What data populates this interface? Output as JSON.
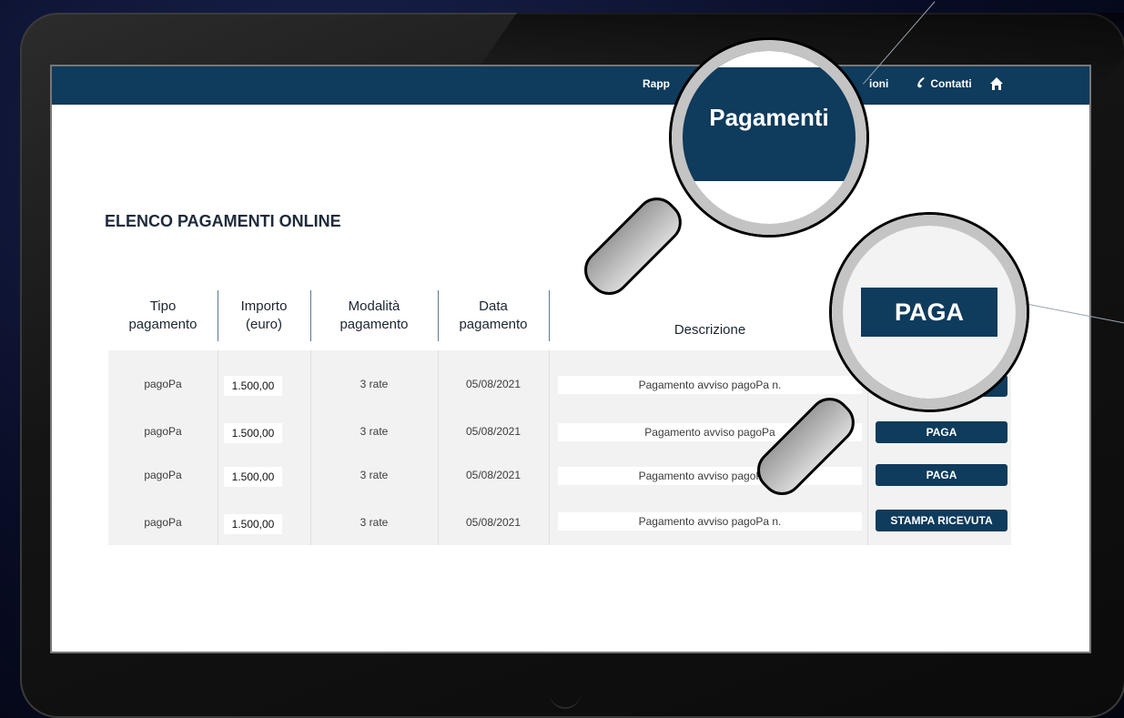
{
  "header": {
    "nav_partial_left": "Rapp",
    "nav_partial_right": "ioni",
    "contacts": "Contatti"
  },
  "page": {
    "title": "ELENCO PAGAMENTI ONLINE"
  },
  "table": {
    "headers": [
      {
        "line1": "Tipo",
        "line2": "pagamento"
      },
      {
        "line1": "Importo",
        "line2": "(euro)"
      },
      {
        "line1": "Modalità",
        "line2": "pagamento"
      },
      {
        "line1": "Data",
        "line2": "pagamento"
      },
      {
        "line1": "Descrizione",
        "line2": ""
      }
    ],
    "rows": [
      {
        "tipo": "pagoPa",
        "importo": "1.500,00",
        "modalita": "3 rate",
        "data": "05/08/2021",
        "descrizione": "Pagamento avviso pagoPa n.",
        "action": ""
      },
      {
        "tipo": "pagoPa",
        "importo": "1.500,00",
        "modalita": "3 rate",
        "data": "05/08/2021",
        "descrizione": "Pagamento avviso pagoPa",
        "action": "PAGA"
      },
      {
        "tipo": "pagoPa",
        "importo": "1.500,00",
        "modalita": "3 rate",
        "data": "05/08/2021",
        "descrizione": "Pagamento avviso pagoPa n.",
        "action": "PAGA"
      },
      {
        "tipo": "pagoPa",
        "importo": "1.500,00",
        "modalita": "3 rate",
        "data": "05/08/2021",
        "descrizione": "Pagamento avviso pagoPa n.",
        "action": "STAMPA RICEVUTA"
      }
    ]
  },
  "magnifiers": {
    "nav_zoom": "Pagamenti",
    "button_zoom": "PAGA"
  },
  "colors": {
    "primary": "#0f3b5c",
    "lens_ring": "#c4c4c4"
  }
}
